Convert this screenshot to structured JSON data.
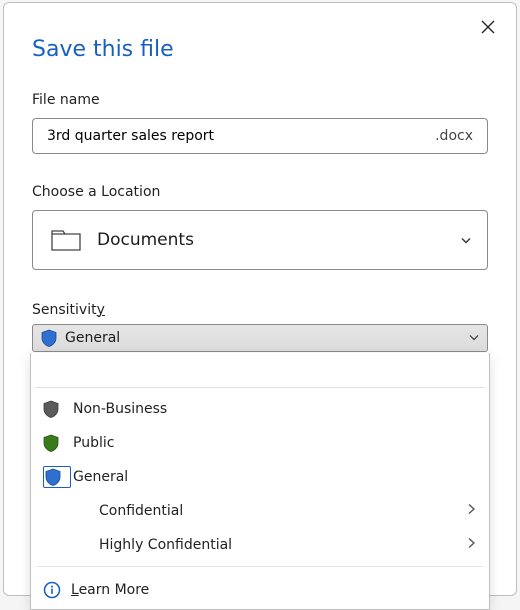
{
  "dialog": {
    "title": "Save this file",
    "filename_label": "File name",
    "filename_value": "3rd quarter sales report",
    "filename_ext": ".docx",
    "location_label": "Choose a Location",
    "location_value": "Documents",
    "sensitivity_label": "Sensitivity",
    "sensitivity_selected": "General"
  },
  "sensitivity_options": {
    "nonbusiness": {
      "label": "Non-Business",
      "shield_color": "#5b5b5b",
      "has_submenu": false
    },
    "public": {
      "label": "Public",
      "shield_color": "#3a7a1a",
      "has_submenu": false
    },
    "general": {
      "label": "General",
      "shield_color": "#2f6fd0",
      "has_submenu": false,
      "selected": true
    },
    "confidential": {
      "label": "Confidential",
      "has_submenu": true
    },
    "highly": {
      "label": "Highly Confidential",
      "has_submenu": true
    }
  },
  "learn_more": {
    "label": "Learn More"
  },
  "colors": {
    "accent": "#1860c0",
    "shield_selected": "#2f6fd0"
  }
}
